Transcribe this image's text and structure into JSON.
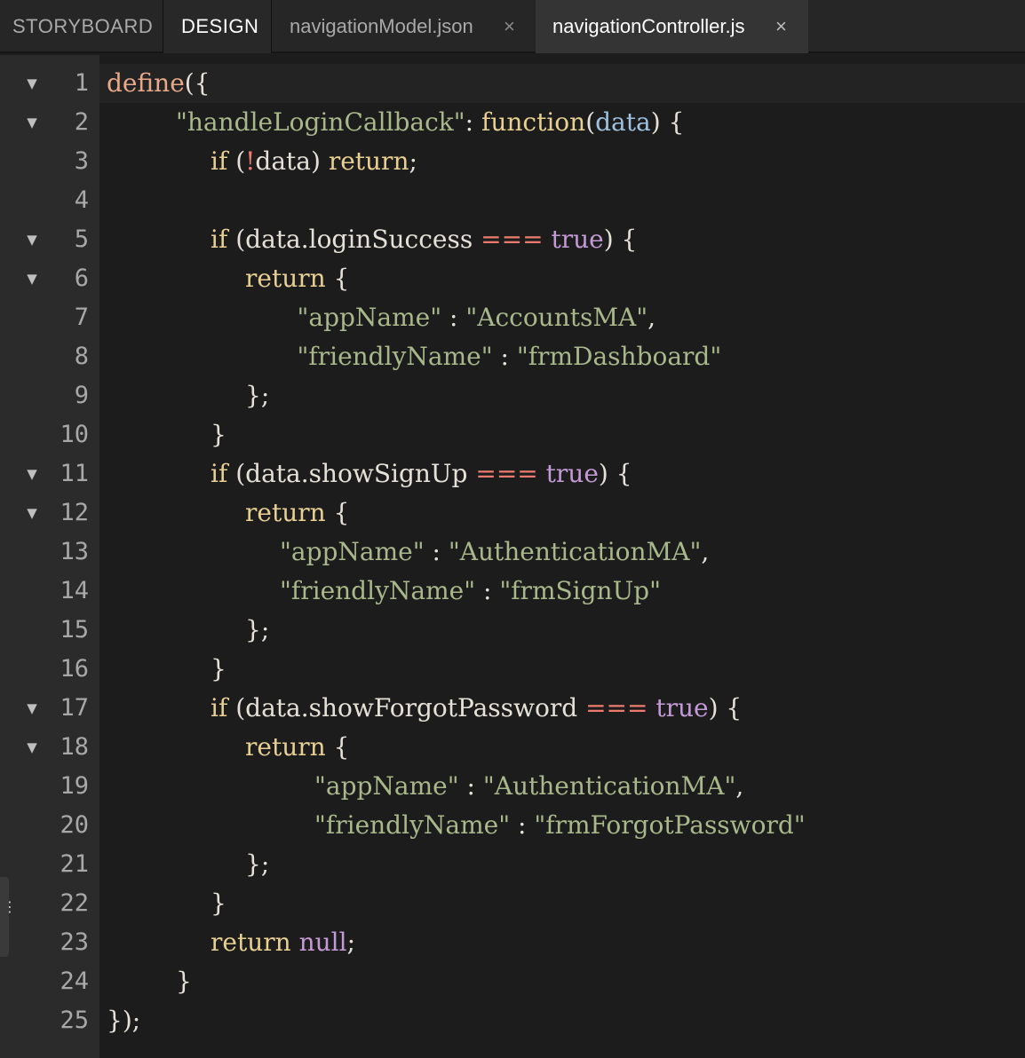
{
  "tabs": [
    {
      "label": "STORYBOARD"
    },
    {
      "label": "DESIGN"
    },
    {
      "label": "navigationModel.json",
      "close": "×"
    },
    {
      "label": "navigationController.js",
      "close": "×"
    }
  ],
  "colors": {
    "keyword": "#e8cf92",
    "declaration": "#e8a98a",
    "string": "#a8b88b",
    "operator": "#ec7a6e",
    "literal": "#c49ad6",
    "param": "#9fc2e0",
    "text": "#e6e1d8"
  },
  "editor": {
    "lines": [
      {
        "n": "1",
        "fold": "▼",
        "indent": 0,
        "tokens": [
          [
            "declaration",
            "define"
          ],
          [
            "text",
            "({"
          ]
        ]
      },
      {
        "n": "2",
        "fold": "▼",
        "indent": 2,
        "tokens": [
          [
            "string",
            "\"handleLoginCallback\""
          ],
          [
            "text",
            ": "
          ],
          [
            "keyword",
            "function"
          ],
          [
            "text",
            "("
          ],
          [
            "param",
            "data"
          ],
          [
            "text",
            ") {"
          ]
        ]
      },
      {
        "n": "3",
        "fold": "",
        "indent": 3,
        "tokens": [
          [
            "keyword",
            "if"
          ],
          [
            "text",
            " ("
          ],
          [
            "operator",
            "!"
          ],
          [
            "text",
            "data) "
          ],
          [
            "keyword",
            "return"
          ],
          [
            "text",
            ";"
          ]
        ]
      },
      {
        "n": "4",
        "fold": "",
        "indent": 0,
        "tokens": []
      },
      {
        "n": "5",
        "fold": "▼",
        "indent": 3,
        "tokens": [
          [
            "keyword",
            "if"
          ],
          [
            "text",
            " (data.loginSuccess "
          ],
          [
            "operator",
            "==="
          ],
          [
            "text",
            " "
          ],
          [
            "literal",
            "true"
          ],
          [
            "text",
            ") {"
          ]
        ]
      },
      {
        "n": "6",
        "fold": "▼",
        "indent": 4,
        "tokens": [
          [
            "keyword",
            "return"
          ],
          [
            "text",
            " {"
          ]
        ]
      },
      {
        "n": "7",
        "fold": "",
        "indent": 5.5,
        "tokens": [
          [
            "string",
            "\"appName\""
          ],
          [
            "text",
            " : "
          ],
          [
            "string",
            "\"AccountsMA\""
          ],
          [
            "text",
            ","
          ]
        ]
      },
      {
        "n": "8",
        "fold": "",
        "indent": 5.5,
        "tokens": [
          [
            "string",
            "\"friendlyName\""
          ],
          [
            "text",
            " : "
          ],
          [
            "string",
            "\"frmDashboard\""
          ]
        ]
      },
      {
        "n": "9",
        "fold": "",
        "indent": 4,
        "tokens": [
          [
            "text",
            "};"
          ]
        ]
      },
      {
        "n": "10",
        "fold": "",
        "indent": 3,
        "tokens": [
          [
            "text",
            "}"
          ]
        ]
      },
      {
        "n": "11",
        "fold": "▼",
        "indent": 3,
        "tokens": [
          [
            "keyword",
            "if"
          ],
          [
            "text",
            " (data.showSignUp "
          ],
          [
            "operator",
            "==="
          ],
          [
            "text",
            " "
          ],
          [
            "literal",
            "true"
          ],
          [
            "text",
            ") {"
          ]
        ]
      },
      {
        "n": "12",
        "fold": "▼",
        "indent": 4,
        "tokens": [
          [
            "keyword",
            "return"
          ],
          [
            "text",
            " {"
          ]
        ]
      },
      {
        "n": "13",
        "fold": "",
        "indent": 5,
        "tokens": [
          [
            "string",
            "\"appName\""
          ],
          [
            "text",
            " : "
          ],
          [
            "string",
            "\"AuthenticationMA\""
          ],
          [
            "text",
            ","
          ]
        ]
      },
      {
        "n": "14",
        "fold": "",
        "indent": 5,
        "tokens": [
          [
            "string",
            "\"friendlyName\""
          ],
          [
            "text",
            " : "
          ],
          [
            "string",
            "\"frmSignUp\""
          ]
        ]
      },
      {
        "n": "15",
        "fold": "",
        "indent": 4,
        "tokens": [
          [
            "text",
            "};"
          ]
        ]
      },
      {
        "n": "16",
        "fold": "",
        "indent": 3,
        "tokens": [
          [
            "text",
            "}"
          ]
        ]
      },
      {
        "n": "17",
        "fold": "▼",
        "indent": 3,
        "tokens": [
          [
            "keyword",
            "if"
          ],
          [
            "text",
            " (data.showForgotPassword "
          ],
          [
            "operator",
            "==="
          ],
          [
            "text",
            " "
          ],
          [
            "literal",
            "true"
          ],
          [
            "text",
            ") {"
          ]
        ]
      },
      {
        "n": "18",
        "fold": "▼",
        "indent": 4,
        "tokens": [
          [
            "keyword",
            "return"
          ],
          [
            "text",
            " {"
          ]
        ]
      },
      {
        "n": "19",
        "fold": "",
        "indent": 6,
        "tokens": [
          [
            "string",
            "\"appName\""
          ],
          [
            "text",
            " : "
          ],
          [
            "string",
            "\"AuthenticationMA\""
          ],
          [
            "text",
            ","
          ]
        ]
      },
      {
        "n": "20",
        "fold": "",
        "indent": 6,
        "tokens": [
          [
            "string",
            "\"friendlyName\""
          ],
          [
            "text",
            " : "
          ],
          [
            "string",
            "\"frmForgotPassword\""
          ]
        ]
      },
      {
        "n": "21",
        "fold": "",
        "indent": 4,
        "tokens": [
          [
            "text",
            "};"
          ]
        ]
      },
      {
        "n": "22",
        "fold": "",
        "indent": 3,
        "tokens": [
          [
            "text",
            "}"
          ]
        ]
      },
      {
        "n": "23",
        "fold": "",
        "indent": 3,
        "tokens": [
          [
            "keyword",
            "return"
          ],
          [
            "text",
            " "
          ],
          [
            "literal",
            "null"
          ],
          [
            "text",
            ";"
          ]
        ]
      },
      {
        "n": "24",
        "fold": "",
        "indent": 2,
        "tokens": [
          [
            "text",
            "}"
          ]
        ]
      },
      {
        "n": "25",
        "fold": "",
        "indent": 0,
        "tokens": [
          [
            "text",
            "});"
          ]
        ]
      }
    ]
  },
  "splitter": {
    "icon": "vertical-dots-icon",
    "glyph": "⋮"
  }
}
